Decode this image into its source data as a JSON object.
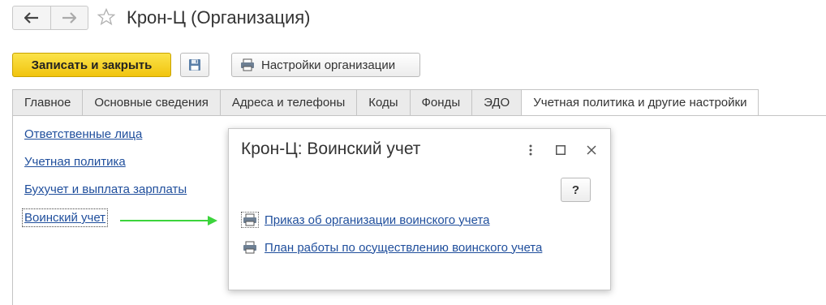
{
  "window": {
    "title": "Крон-Ц (Организация)",
    "back_icon": "arrow-left-icon",
    "forward_icon": "arrow-right-icon",
    "favorite_icon": "star-icon"
  },
  "toolbar": {
    "save_close_label": "Записать и закрыть",
    "save_icon": "floppy-disk-icon",
    "settings_label": "Настройки организации",
    "settings_icon": "printer-icon",
    "accent_color": "#f5cc1f"
  },
  "tabs": [
    {
      "label": "Главное",
      "active": false
    },
    {
      "label": "Основные сведения",
      "active": false
    },
    {
      "label": "Адреса и телефоны",
      "active": false
    },
    {
      "label": "Коды",
      "active": false
    },
    {
      "label": "Фонды",
      "active": false
    },
    {
      "label": "ЭДО",
      "active": false
    },
    {
      "label": "Учетная политика и другие настройки",
      "active": true
    }
  ],
  "sections": [
    {
      "label": "Ответственные лица"
    },
    {
      "label": "Учетная политика"
    },
    {
      "label": "Бухучет и выплата зарплаты"
    },
    {
      "label": "Воинский учет"
    }
  ],
  "dialog": {
    "title": "Крон-Ц: Воинский учет",
    "help_label": "?",
    "more_icon": "more-vertical-icon",
    "maximize_icon": "maximize-icon",
    "close_icon": "close-icon",
    "links": [
      {
        "label": "Приказ об организации воинского учета",
        "icon": "printer-icon"
      },
      {
        "label": "План работы по осуществлению воинского учета",
        "icon": "printer-icon"
      }
    ]
  },
  "annotation": {
    "color": "#3cd43c"
  }
}
